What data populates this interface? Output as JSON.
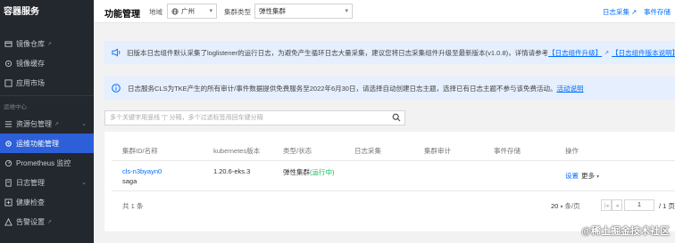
{
  "sidebar": {
    "title": "容器服务",
    "items": [
      {
        "label": "镜像仓库",
        "external": true
      },
      {
        "label": "镜像缓存",
        "external": false
      },
      {
        "label": "应用市场",
        "external": false
      }
    ],
    "section_label": "运维中心",
    "ops_items": [
      {
        "label": "资源包管理",
        "external": true,
        "chevron": "⌄"
      },
      {
        "label": "运维功能管理",
        "active": true
      },
      {
        "label": "Prometheus 监控"
      },
      {
        "label": "日志管理",
        "chevron": "⌄"
      },
      {
        "label": "健康检查"
      },
      {
        "label": "告警设置",
        "external": true
      }
    ],
    "ext_glyph": "↗",
    "colors": {
      "bg": "#23272e",
      "active": "#2d5fd9"
    }
  },
  "header": {
    "title": "功能管理",
    "region_label": "地域",
    "region_value": "广州",
    "cluster_type_label": "集群类型",
    "cluster_type_value": "弹性集群",
    "links": [
      "日志采集 ↗",
      "事件存储"
    ]
  },
  "notices": [
    {
      "text": "旧版本日志组件默认采集了loglistener的运行日志，为避免产生循环日志大量采集，建议您将日志采集组件升级至最新版本(v1.0.8)，详情请参考",
      "links": [
        "【日志组件升级】",
        "【日志组件版本说明】"
      ]
    },
    {
      "text": "日志服务CLS为TKE产生的所有审计/事件数据提供免费服务至2022年6月30日，请选择自动创建日志主题，选择已有日志主题不参与该免费活动。",
      "link": "活动说明"
    }
  ],
  "search": {
    "placeholder": "多个关键字用竖线 \"|\" 分隔，多个过滤标签用回车键分隔"
  },
  "table": {
    "columns": [
      "集群ID/名称",
      "kubernetes版本",
      "类型/状态",
      "日志采集",
      "集群审计",
      "事件存储",
      "操作"
    ],
    "rows": [
      {
        "cluster_id": "cls-n3byayn0",
        "cluster_name": "saga",
        "k8s_version": "1.20.6-eks.3",
        "type": "弹性集群",
        "status": "(运行中)",
        "actions": [
          "设置",
          "更多"
        ]
      }
    ],
    "total": "共 1 条",
    "page_size": "20",
    "page_size_suffix": "条/页",
    "page_input": "1",
    "page_total": "/ 1 页"
  },
  "watermark": "@稀土掘金技术社区"
}
